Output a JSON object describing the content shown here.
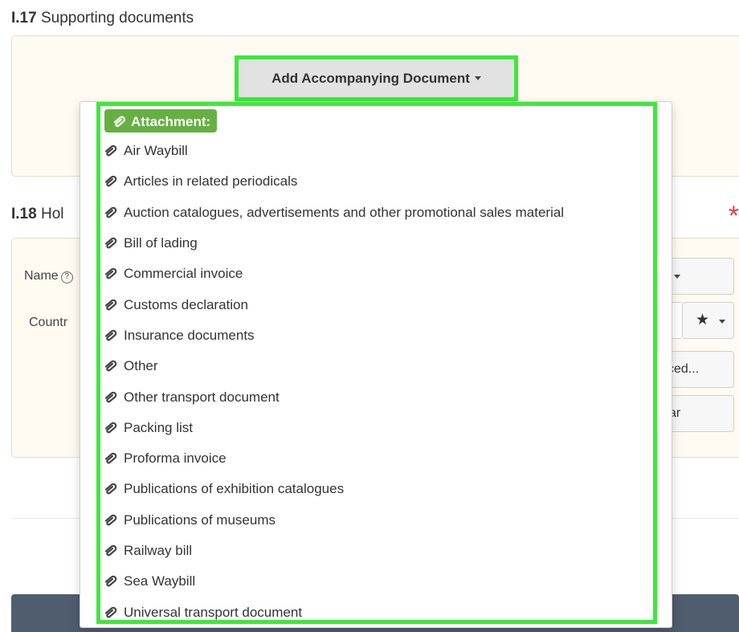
{
  "section17": {
    "number": "I.17",
    "title": "Supporting documents"
  },
  "section18": {
    "number": "I.18",
    "title": "Hol"
  },
  "required_marker": "*",
  "form": {
    "name_label": "Name",
    "help_icon_char": "?",
    "country_label": "Countr",
    "advanced_button_fragment": "ced...",
    "clear_button_fragment": "ar"
  },
  "dropdown": {
    "toggle_label": "Add Accompanying Document",
    "group_label": "Attachment:",
    "items": [
      "Air Waybill",
      "Articles in related periodicals",
      "Auction catalogues, advertisements and other promotional sales material",
      "Bill of lading",
      "Commercial invoice",
      "Customs declaration",
      "Insurance documents",
      "Other",
      "Other transport document",
      "Packing list",
      "Proforma invoice",
      "Publications of exhibition catalogues",
      "Publications of museums",
      "Railway bill",
      "Sea Waybill",
      "Universal transport document"
    ]
  },
  "colors": {
    "highlight": "#3ee83a",
    "badge": "#66b043",
    "panel_bg": "#fffbf2",
    "required": "#e0423a",
    "footer": "#4f5d6e"
  }
}
